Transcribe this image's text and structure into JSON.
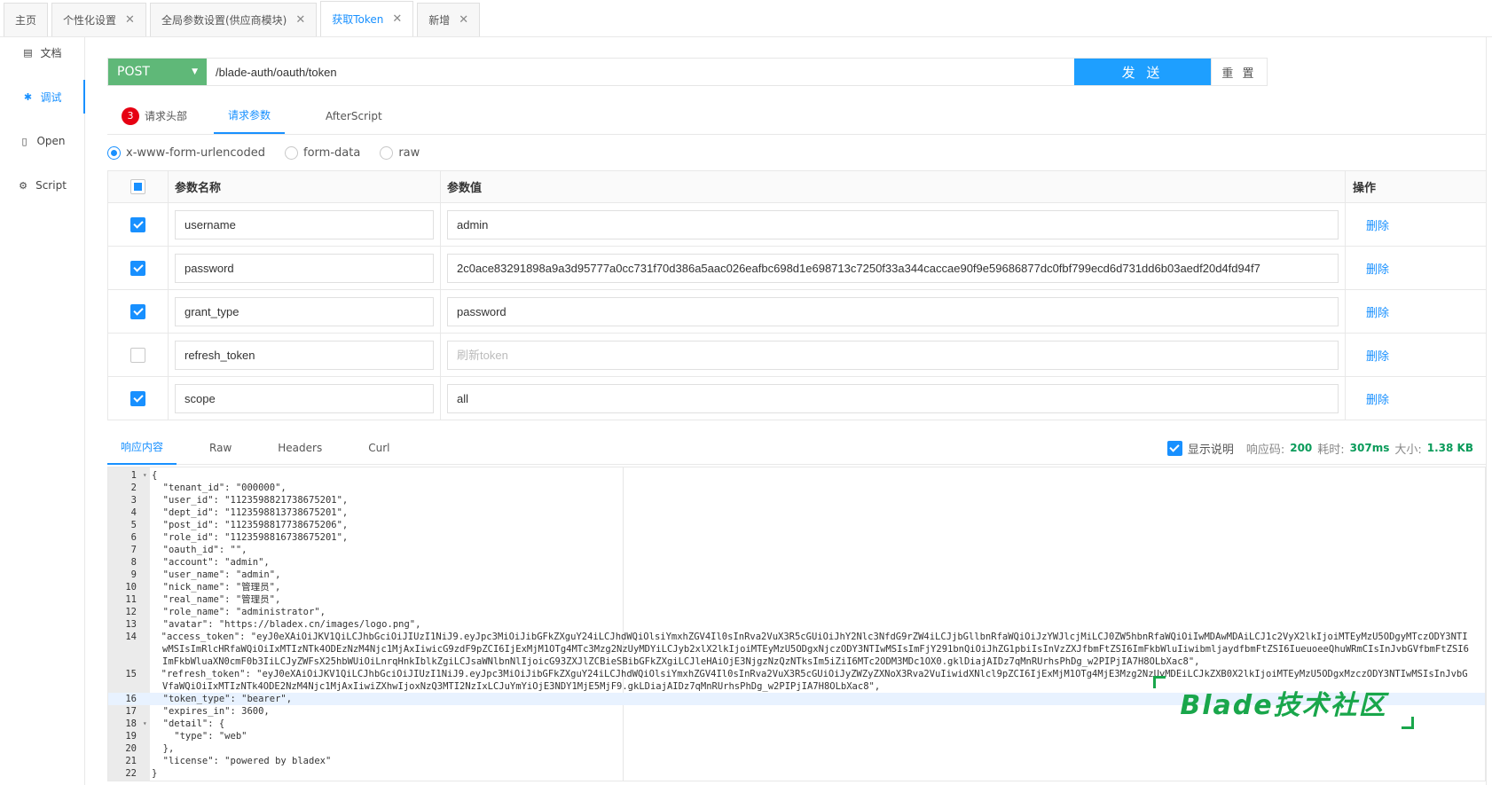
{
  "tabs": [
    {
      "label": "主页",
      "closable": false,
      "active": false
    },
    {
      "label": "个性化设置",
      "closable": true,
      "active": false
    },
    {
      "label": "全局参数设置(供应商模块)",
      "closable": true,
      "active": false
    },
    {
      "label": "获取Token",
      "closable": true,
      "active": true
    },
    {
      "label": "新增",
      "closable": true,
      "active": false
    }
  ],
  "sidebar": {
    "items": [
      {
        "label": "文档",
        "icon": "document-icon",
        "active": false
      },
      {
        "label": "调试",
        "icon": "debug-icon",
        "active": true
      },
      {
        "label": "Open",
        "icon": "file-icon",
        "active": false
      },
      {
        "label": "Script",
        "icon": "gear-icon",
        "active": false
      }
    ]
  },
  "request": {
    "method": "POST",
    "url": "/blade-auth/oauth/token",
    "send_label": "发 送",
    "reset_label": "重 置"
  },
  "request_tabs": {
    "headers_badge": "3",
    "headers_label": "请求头部",
    "params_label": "请求参数",
    "afterscript_label": "AfterScript"
  },
  "body_types": {
    "urlencoded": "x-www-form-urlencoded",
    "formdata": "form-data",
    "raw": "raw",
    "selected": "x-www-form-urlencoded"
  },
  "params_table": {
    "col_name": "参数名称",
    "col_value": "参数值",
    "col_op": "操作",
    "delete_label": "删除",
    "rows": [
      {
        "checked": true,
        "name": "username",
        "value": "admin",
        "placeholder": ""
      },
      {
        "checked": true,
        "name": "password",
        "value": "2c0ace83291898a9a3d95777a0cc731f70d386a5aac026eafbc698d1e698713c7250f33a344caccae90f9e59686877dc0fbf799ecd6d731dd6b03aedf20d4fd94f7",
        "placeholder": ""
      },
      {
        "checked": true,
        "name": "grant_type",
        "value": "password",
        "placeholder": ""
      },
      {
        "checked": false,
        "name": "refresh_token",
        "value": "",
        "placeholder": "刷新token"
      },
      {
        "checked": true,
        "name": "scope",
        "value": "all",
        "placeholder": ""
      }
    ]
  },
  "response_tabs": {
    "content": "响应内容",
    "raw": "Raw",
    "headers": "Headers",
    "curl": "Curl"
  },
  "response_info": {
    "show_desc_label": "显示说明",
    "show_desc_checked": true,
    "code_label": "响应码:",
    "code": "200",
    "time_label": "耗时:",
    "time": "307ms",
    "size_label": "大小:",
    "size": "1.38 KB"
  },
  "response_lines": [
    {
      "n": "1",
      "fold": true,
      "text": "{"
    },
    {
      "n": "2",
      "text": "  \"tenant_id\": \"000000\","
    },
    {
      "n": "3",
      "text": "  \"user_id\": \"1123598821738675201\","
    },
    {
      "n": "4",
      "text": "  \"dept_id\": \"1123598813738675201\","
    },
    {
      "n": "5",
      "text": "  \"post_id\": \"1123598817738675206\","
    },
    {
      "n": "6",
      "text": "  \"role_id\": \"1123598816738675201\","
    },
    {
      "n": "7",
      "text": "  \"oauth_id\": \"\","
    },
    {
      "n": "8",
      "text": "  \"account\": \"admin\","
    },
    {
      "n": "9",
      "text": "  \"user_name\": \"admin\","
    },
    {
      "n": "10",
      "text": "  \"nick_name\": \"管理员\","
    },
    {
      "n": "11",
      "text": "  \"real_name\": \"管理员\","
    },
    {
      "n": "12",
      "text": "  \"role_name\": \"administrator\","
    },
    {
      "n": "13",
      "text": "  \"avatar\": \"https://bladex.cn/images/logo.png\","
    },
    {
      "n": "14",
      "wrap": true,
      "text": "  \"access_token\": \"eyJ0eXAiOiJKV1QiLCJhbGciOiJIUzI1NiJ9.eyJpc3MiOiJibGFkZXguY24iLCJhdWQiOlsiYmxhZGV4Il0sInRva2VuX3R5cGUiOiJhY2Nlc3NfdG9rZW4iLCJjbGllbnRfaWQiOiJzYWJlcjMiLCJ0ZW5hbnRfaWQiOiIwMDAwMDAiLCJ1c2VyX2lkIjoiMTEyMzU5ODgyMTczODY3NTIwMSIsImRlcHRfaWQiOiIxMTIzNTk4ODEzNzM4Njc1MjAxIiwicG9zdF9pZCI6IjExMjM1OTg4MTc3Mzg2NzUyMDYiLCJyb2xlX2lkIjoiMTEyMzU5ODgxNjczODY3NTIwMSIsImFjY291bnQiOiJhZG1pbiIsInVzZXJfbmFtZSI6ImFkbWluIiwibmljaydfbmFtZSI6IueuoeeQhuWRmCIsInJvbGVfbmFtZSI6ImFkbWluaXN0cmF0b3IiLCJyZWFsX25hbWUiOiLnrqHnkIblkZgiLCJsaWNlbnNlIjoicG93ZXJlZCBieSBibGFkZXgiLCJleHAiOjE3NjgzNzQzNTksIm5iZiI6MTc2ODM3MDc1OX0.gklDiajAIDz7qMnRUrhsPhDg_w2PIPjIA7H8OLbXac8\","
    },
    {
      "n": "15",
      "wrap": true,
      "text": "  \"refresh_token\": \"eyJ0eXAiOiJKV1QiLCJhbGciOiJIUzI1NiJ9.eyJpc3MiOiJibGFkZXguY24iLCJhdWQiOlsiYmxhZGV4Il0sInRva2VuX3R5cGUiOiJyZWZyZXNoX3Rva2VuIiwidXNlcl9pZCI6IjExMjM1OTg4MjE3Mzg2NzUyMDEiLCJkZXB0X2lkIjoiMTEyMzU5ODgxMzczODY3NTIwMSIsInJvbGVfaWQiOiIxMTIzNTk4ODE2NzM4Njc1MjAxIiwiZXhwIjoxNzQ3MTI2NzIxLCJuYmYiOjE3NDY1MjE5MjF9.gkLDiajAIDz7qMnRUrhsPhDg_w2PIPjIA7H8OLbXac8\","
    },
    {
      "n": "16",
      "text": "  \"token_type\": \"bearer\",",
      "current": true
    },
    {
      "n": "17",
      "text": "  \"expires_in\": 3600,"
    },
    {
      "n": "18",
      "fold": true,
      "text": "  \"detail\": {"
    },
    {
      "n": "19",
      "text": "    \"type\": \"web\""
    },
    {
      "n": "20",
      "text": "  },"
    },
    {
      "n": "21",
      "text": "  \"license\": \"powered by bladex\""
    },
    {
      "n": "22",
      "text": "}"
    }
  ],
  "watermark": "Blade技术社区",
  "colors": {
    "accent": "#1890ff",
    "method_bg": "#5fb878",
    "send_bg": "#1e9fff",
    "badge": "#e60012",
    "watermark": "#19a64b"
  }
}
